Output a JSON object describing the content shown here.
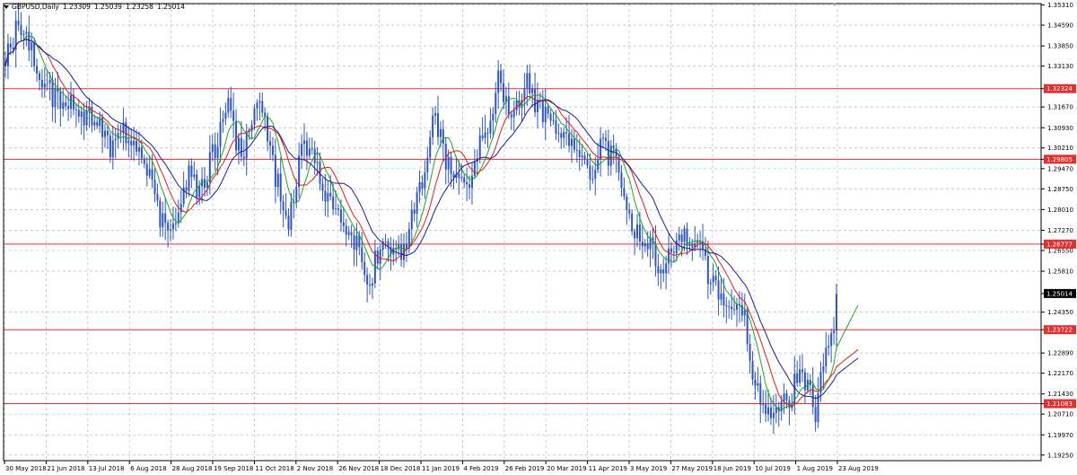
{
  "header": {
    "symbol": "GBPUSD,Daily",
    "open": "1.23309",
    "high": "1.25039",
    "low": "1.23258",
    "close": "1.25014"
  },
  "colors": {
    "candle": "#2f56b8",
    "ma_fast": "#1fa51f",
    "ma_mid": "#d61f1f",
    "ma_slow": "#1a1a9e",
    "level": "#e03030",
    "level_label_bg": "#e03030",
    "price_label_bg": "#000000",
    "grid": "#b8b8b8"
  },
  "chart_data": {
    "type": "candlestick",
    "ylim": [
      1.1905,
      1.3536
    ],
    "y_ticks": [
      "1.35310",
      "1.34590",
      "1.33850",
      "1.33130",
      "1.32324",
      "1.31670",
      "1.30930",
      "1.30210",
      "1.29805",
      "1.29470",
      "1.28750",
      "1.28010",
      "1.27270",
      "1.26777",
      "1.26550",
      "1.25810",
      "1.25014",
      "1.24350",
      "1.23722",
      "1.22890",
      "1.22170",
      "1.21430",
      "1.21083",
      "1.20710",
      "1.19970",
      "1.19250"
    ],
    "x_ticks": [
      "30 May 2018",
      "21 Jun 2018",
      "13 Jul 2018",
      "6 Aug 2018",
      "28 Aug 2018",
      "19 Sep 2018",
      "11 Oct 2018",
      "2 Nov 2018",
      "26 Nov 2018",
      "18 Dec 2018",
      "11 Jan 2019",
      "4 Feb 2019",
      "26 Feb 2019",
      "20 Mar 2019",
      "11 Apr 2019",
      "3 May 2019",
      "27 May 2019",
      "18 Jun 2019",
      "10 Jul 2019",
      "1 Aug 2019",
      "23 Aug 2019"
    ],
    "horizontal_levels": [
      "1.32324",
      "1.29805",
      "1.26777",
      "1.23722",
      "1.21083"
    ],
    "current_price": "1.25014",
    "price_anchors": [
      [
        0,
        1.335
      ],
      [
        5,
        1.345
      ],
      [
        10,
        1.336
      ],
      [
        15,
        1.325
      ],
      [
        20,
        1.318
      ],
      [
        25,
        1.32
      ],
      [
        30,
        1.313
      ],
      [
        35,
        1.312
      ],
      [
        40,
        1.3
      ],
      [
        45,
        1.308
      ],
      [
        50,
        1.3
      ],
      [
        55,
        1.292
      ],
      [
        58,
        1.28
      ],
      [
        62,
        1.272
      ],
      [
        66,
        1.282
      ],
      [
        70,
        1.292
      ],
      [
        74,
        1.285
      ],
      [
        78,
        1.297
      ],
      [
        82,
        1.308
      ],
      [
        86,
        1.318
      ],
      [
        88,
        1.304
      ],
      [
        91,
        1.302
      ],
      [
        94,
        1.31
      ],
      [
        97,
        1.316
      ],
      [
        100,
        1.307
      ],
      [
        103,
        1.292
      ],
      [
        106,
        1.282
      ],
      [
        108,
        1.275
      ],
      [
        110,
        1.287
      ],
      [
        113,
        1.303
      ],
      [
        116,
        1.301
      ],
      [
        120,
        1.29
      ],
      [
        124,
        1.283
      ],
      [
        128,
        1.278
      ],
      [
        132,
        1.272
      ],
      [
        136,
        1.263
      ],
      [
        139,
        1.254
      ],
      [
        141,
        1.262
      ],
      [
        145,
        1.266
      ],
      [
        148,
        1.265
      ],
      [
        151,
        1.266
      ],
      [
        154,
        1.273
      ],
      [
        158,
        1.287
      ],
      [
        161,
        1.3
      ],
      [
        163,
        1.315
      ],
      [
        166,
        1.308
      ],
      [
        168,
        1.298
      ],
      [
        171,
        1.292
      ],
      [
        174,
        1.288
      ],
      [
        176,
        1.285
      ],
      [
        179,
        1.3
      ],
      [
        182,
        1.305
      ],
      [
        185,
        1.313
      ],
      [
        188,
        1.33
      ],
      [
        190,
        1.322
      ],
      [
        193,
        1.315
      ],
      [
        196,
        1.318
      ],
      [
        198,
        1.327
      ],
      [
        201,
        1.32
      ],
      [
        203,
        1.318
      ],
      [
        206,
        1.314
      ],
      [
        208,
        1.315
      ],
      [
        211,
        1.307
      ],
      [
        214,
        1.305
      ],
      [
        217,
        1.302
      ],
      [
        220,
        1.298
      ],
      [
        223,
        1.29
      ],
      [
        226,
        1.3
      ],
      [
        228,
        1.31
      ],
      [
        230,
        1.3
      ],
      [
        232,
        1.3
      ],
      [
        234,
        1.296
      ],
      [
        237,
        1.282
      ],
      [
        240,
        1.272
      ],
      [
        244,
        1.268
      ],
      [
        247,
        1.265
      ],
      [
        250,
        1.26
      ],
      [
        253,
        1.265
      ],
      [
        256,
        1.266
      ],
      [
        259,
        1.272
      ],
      [
        262,
        1.266
      ],
      [
        264,
        1.27
      ],
      [
        267,
        1.26
      ],
      [
        270,
        1.254
      ],
      [
        273,
        1.25
      ],
      [
        276,
        1.245
      ],
      [
        279,
        1.245
      ],
      [
        282,
        1.24
      ],
      [
        285,
        1.222
      ],
      [
        288,
        1.213
      ],
      [
        291,
        1.21
      ],
      [
        294,
        1.206
      ],
      [
        297,
        1.211
      ],
      [
        300,
        1.214
      ],
      [
        303,
        1.225
      ],
      [
        306,
        1.216
      ],
      [
        309,
        1.207
      ],
      [
        311,
        1.22
      ],
      [
        313,
        1.232
      ],
      [
        315,
        1.233
      ],
      [
        316,
        1.233
      ],
      [
        317,
        1.25
      ]
    ]
  }
}
